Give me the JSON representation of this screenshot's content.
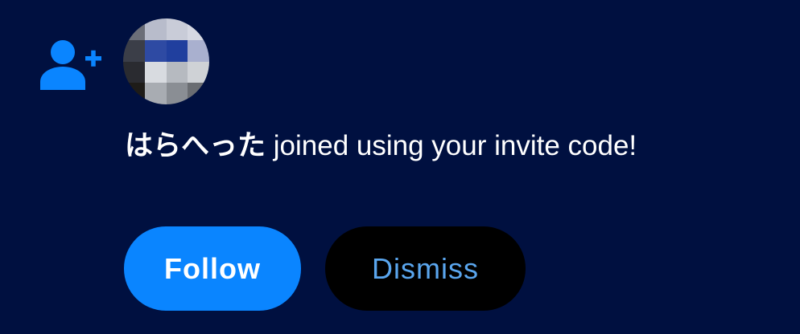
{
  "notification": {
    "type_icon": "add-user-icon",
    "avatar_icon": "avatar",
    "user_name": "はらへった",
    "message_rest": " joined using your invite code!",
    "accent_color": "#0a85ff",
    "background_color": "#001040"
  },
  "actions": {
    "follow_label": "Follow",
    "dismiss_label": "Dismiss"
  },
  "avatar_pixels": [
    "#6b6e78",
    "#b8bccb",
    "#c9ccd8",
    "#d6d8e2",
    "#3b3e48",
    "#2e4aa3",
    "#203f9e",
    "#a9b0cf",
    "#2a2b30",
    "#d8dbe0",
    "#b6bac0",
    "#cfd2d6",
    "#1e1c18",
    "#a8acb2",
    "#8a8e94",
    "#6a6d72"
  ]
}
